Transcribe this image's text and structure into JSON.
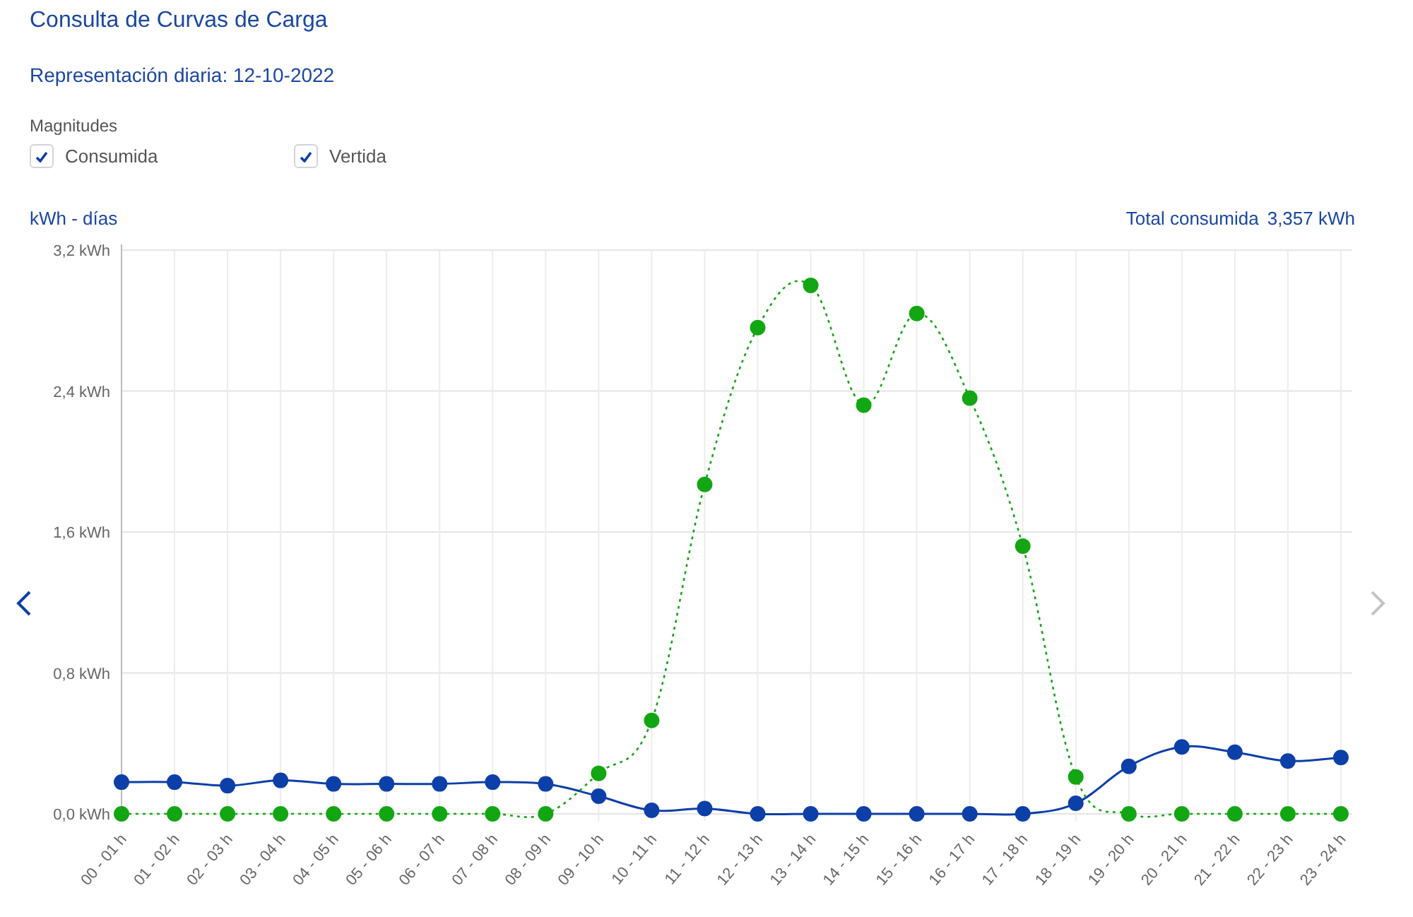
{
  "title": "Consulta de Curvas de Carga",
  "subtitle": "Representación diaria: 12-10-2022",
  "magnitudes": {
    "label": "Magnitudes",
    "options": [
      {
        "label": "Consumida",
        "checked": true
      },
      {
        "label": "Vertida",
        "checked": true
      }
    ]
  },
  "unit_label": "kWh - días",
  "total": {
    "label": "Total consumida",
    "value": "3,357 kWh"
  },
  "nav": {
    "prev": {
      "disabled": false
    },
    "next": {
      "disabled": true
    }
  },
  "chart_data": {
    "type": "line",
    "categories": [
      "00 - 01 h",
      "01 - 02 h",
      "02 - 03 h",
      "03 - 04 h",
      "04 - 05 h",
      "05 - 06 h",
      "06 - 07 h",
      "07 - 08 h",
      "08 - 09 h",
      "09 - 10 h",
      "10 - 11 h",
      "11 - 12 h",
      "12 - 13 h",
      "13 - 14 h",
      "14 - 15 h",
      "15 - 16 h",
      "16 - 17 h",
      "17 - 18 h",
      "18 - 19 h",
      "19 - 20 h",
      "20 - 21 h",
      "21 - 22 h",
      "22 - 23 h",
      "23 - 24 h"
    ],
    "ylim": [
      0,
      3.2
    ],
    "grid": true,
    "yticks": [
      {
        "value": 0,
        "label": "0,0 kWh"
      },
      {
        "value": 0.8,
        "label": "0,8 kWh"
      },
      {
        "value": 1.6,
        "label": "1,6 kWh"
      },
      {
        "value": 2.4,
        "label": "2,4 kWh"
      },
      {
        "value": 3.2,
        "label": "3,2 kWh"
      }
    ],
    "series": [
      {
        "color": "#0d3fa8",
        "line_style": "solid",
        "marker": "circle",
        "values": [
          0.18,
          0.18,
          0.16,
          0.19,
          0.17,
          0.17,
          0.17,
          0.18,
          0.17,
          0.1,
          0.02,
          0.03,
          0,
          0,
          0,
          0,
          0,
          0,
          0.06,
          0.27,
          0.38,
          0.35,
          0.3,
          0.32
        ]
      },
      {
        "color": "#13a613",
        "line_style": "dotted",
        "marker": "circle",
        "values": [
          0,
          0,
          0,
          0,
          0,
          0,
          0,
          0,
          0,
          0.23,
          0.53,
          1.87,
          2.76,
          3.0,
          2.32,
          2.84,
          2.36,
          1.52,
          0.21,
          0,
          0,
          0,
          0,
          0
        ]
      }
    ]
  }
}
